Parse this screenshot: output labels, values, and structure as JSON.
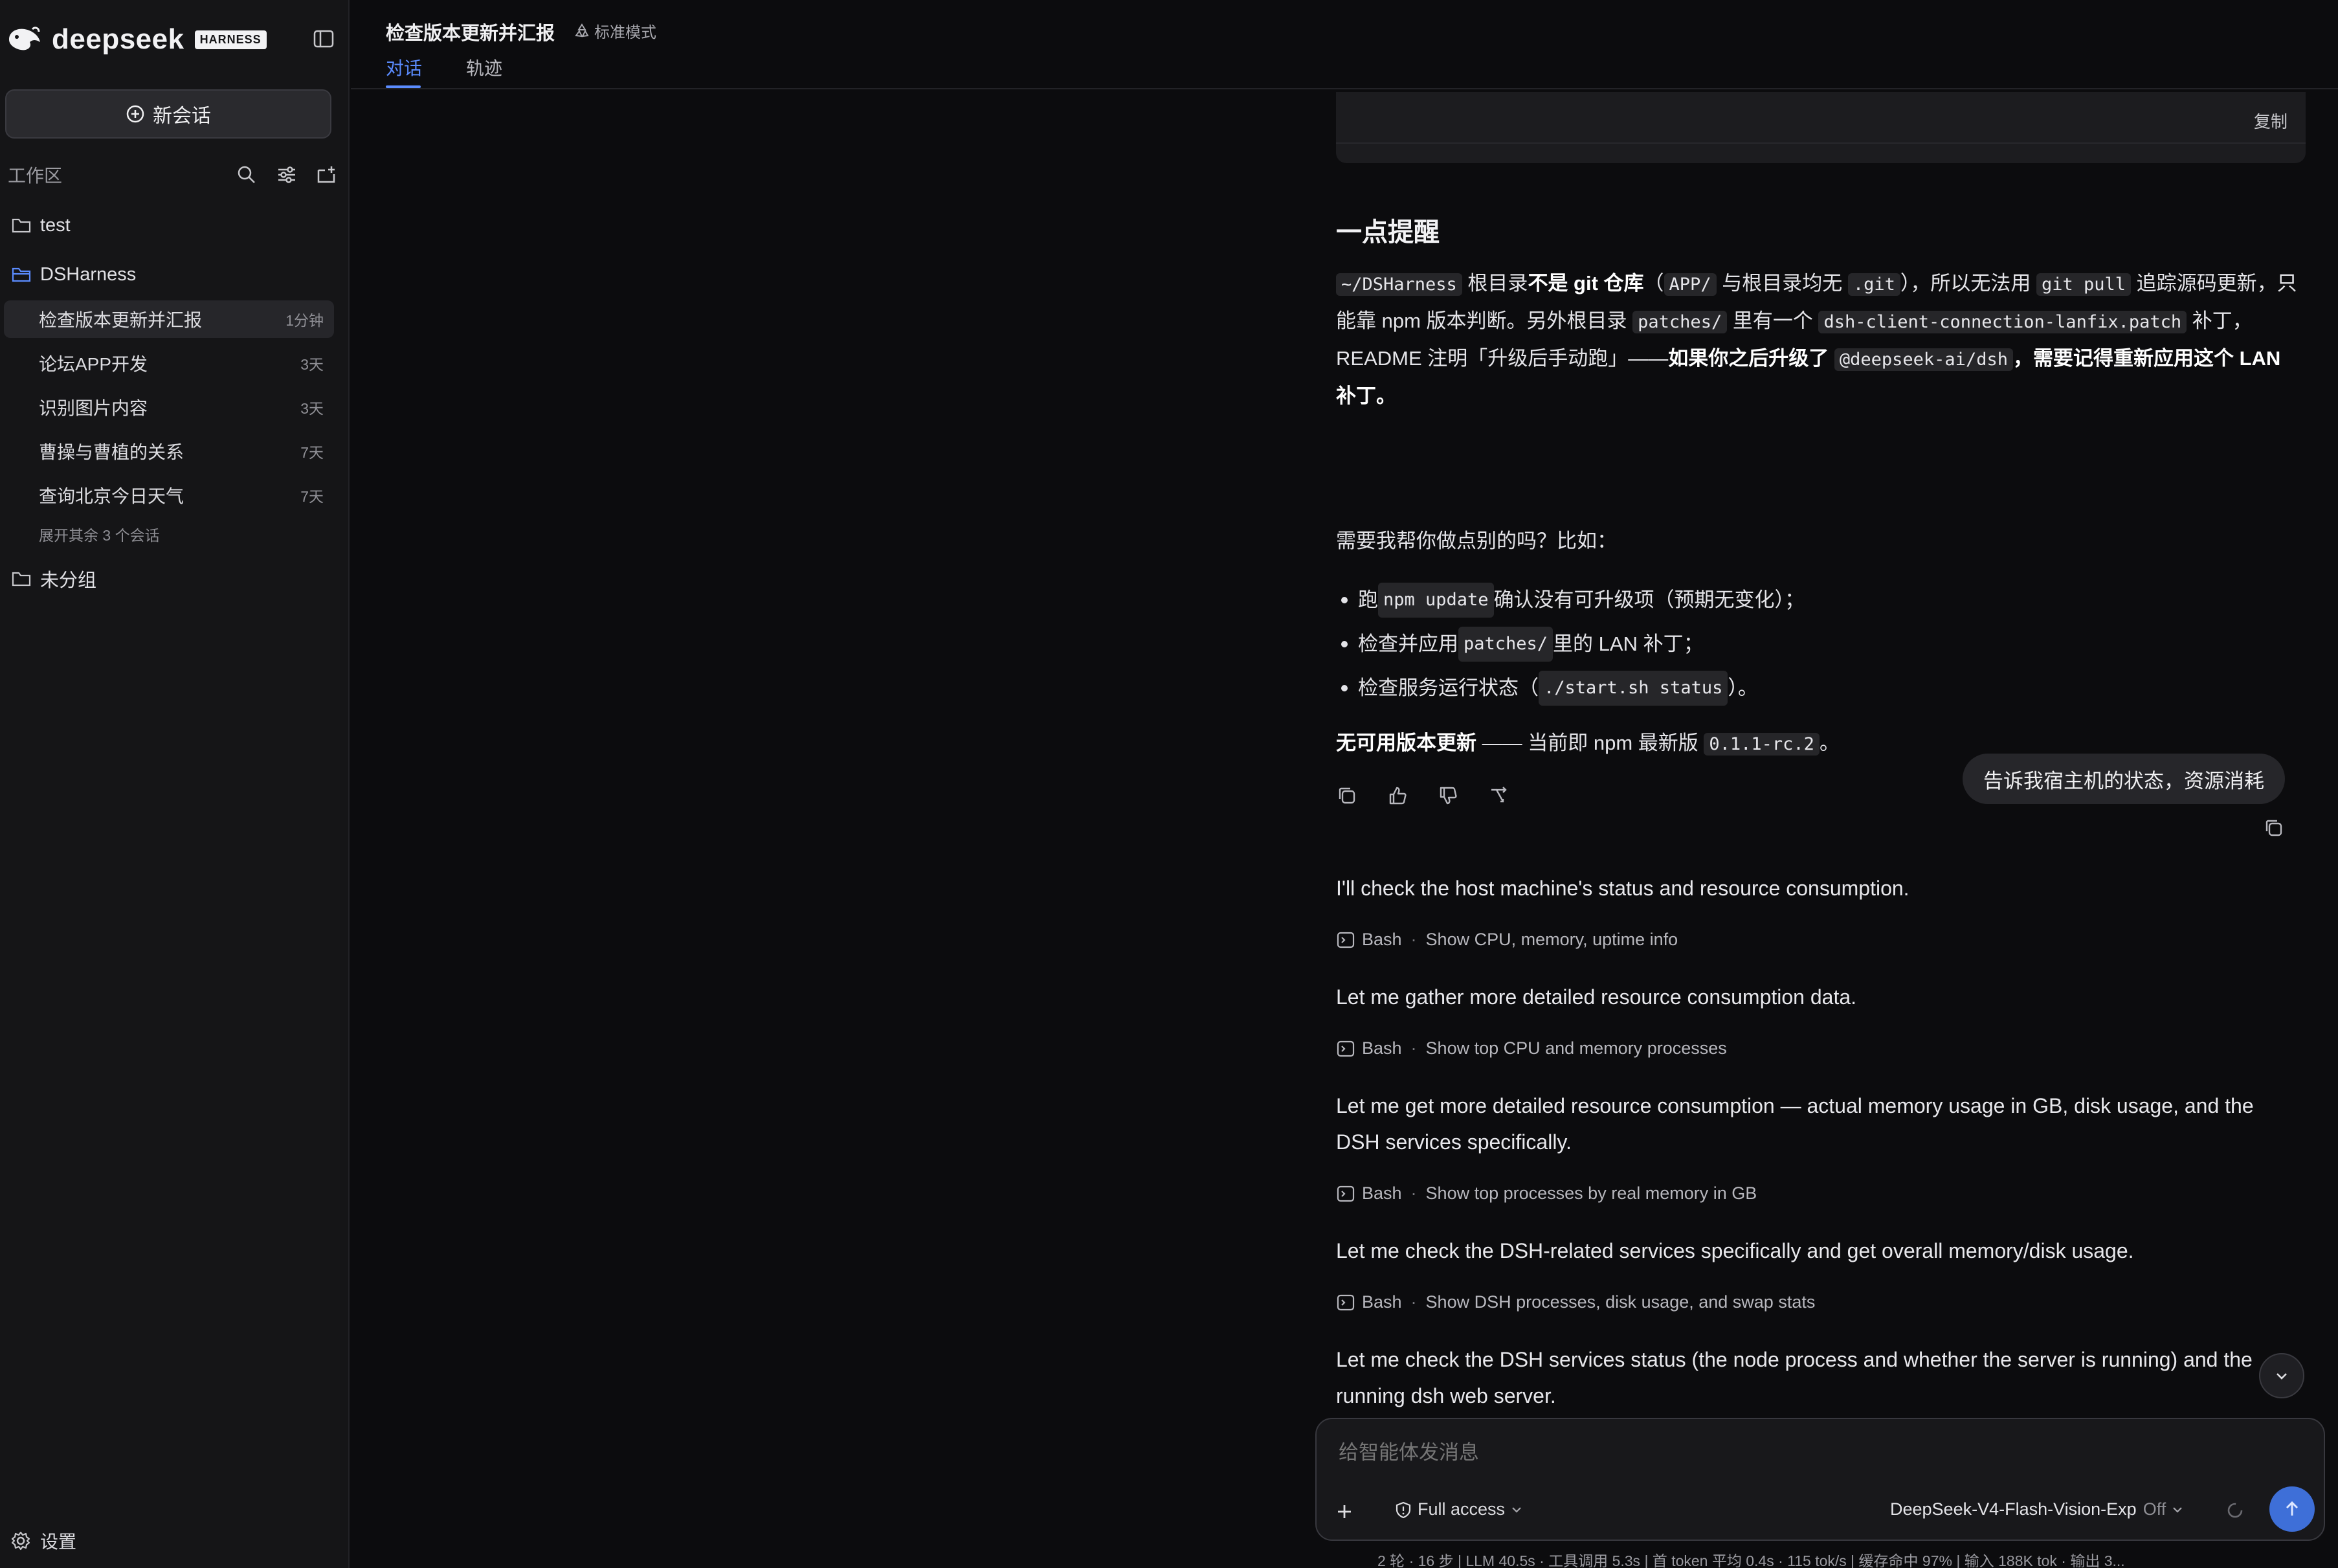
{
  "app": {
    "brand": "deepseek",
    "badge": "HARNESS"
  },
  "sidebar": {
    "new_chat": "新会话",
    "workspace_label": "工作区",
    "folders": [
      {
        "name": "test"
      },
      {
        "name": "DSHarness"
      },
      {
        "name": "未分组"
      }
    ],
    "conversations": [
      {
        "title": "检查版本更新并汇报",
        "age": "1分钟"
      },
      {
        "title": "论坛APP开发",
        "age": "3天"
      },
      {
        "title": "识别图片内容",
        "age": "3天"
      },
      {
        "title": "曹操与曹植的关系",
        "age": "7天"
      },
      {
        "title": "查询北京今日天气",
        "age": "7天"
      }
    ],
    "expand_more": "展开其余 3 个会话",
    "settings": "设置"
  },
  "header": {
    "title": "检查版本更新并汇报",
    "mode": "标准模式",
    "tabs": [
      "对话",
      "轨迹"
    ]
  },
  "chat": {
    "copy_label": "复制",
    "reminder_heading": "一点提醒",
    "reminder": {
      "p1_code1": "~/DSHarness",
      "p1_t1": " 根目录",
      "p1_b1": "不是 git 仓库",
      "p1_t2": "（",
      "p1_code2": "APP/",
      "p1_t3": " 与根目录均无 ",
      "p1_code3": ".git",
      "p1_t4": "），所以无法用 ",
      "p1_code4": "git pull",
      "p1_t5": " 追踪源码更新，只能靠 npm 版本判断。另外根目录 ",
      "p1_code5": "patches/",
      "p1_t6": " 里有一个 ",
      "p1_code6": "dsh-client-connection-lanfix.patch",
      "p1_t7": " 补丁，README 注明「升级后手动跑」——",
      "p1_b2": "如果你之后升级了 ",
      "p1_code7": "@deepseek-ai/dsh",
      "p1_b3": "，需要记得重新应用这个 LAN 补丁。"
    },
    "ask": "需要我帮你做点别的吗？比如：",
    "bullets": [
      {
        "pre": "跑 ",
        "code": "npm update",
        "post": " 确认没有可升级项（预期无变化）；"
      },
      {
        "pre": "检查并应用 ",
        "code": "patches/",
        "post": " 里的 LAN 补丁；"
      },
      {
        "pre": "检查服务运行状态（",
        "code": "./start.sh status",
        "post": "）。"
      }
    ],
    "summary_bold": "无可用版本更新",
    "summary_text": " —— 当前即 npm 最新版 ",
    "summary_code": "0.1.1-rc.2",
    "summary_end": "。",
    "user_message": "告诉我宿主机的状态，资源消耗",
    "assistant_steps": [
      {
        "text": "I'll check the host machine's status and resource consumption.",
        "tool": "Bash",
        "desc": "Show CPU, memory, uptime info"
      },
      {
        "text": "Let me gather more detailed resource consumption data.",
        "tool": "Bash",
        "desc": "Show top CPU and memory processes"
      },
      {
        "text": "Let me get more detailed resource consumption — actual memory usage in GB, disk usage, and the DSH services specifically.",
        "tool": "Bash",
        "desc": "Show top processes by real memory in GB"
      },
      {
        "text": "Let me check the DSH-related services specifically and get overall memory/disk usage.",
        "tool": "Bash",
        "desc": "Show DSH processes, disk usage, and swap stats"
      },
      {
        "text": "Let me check the DSH services status (the node process and whether the server is running) and the running dsh web server."
      }
    ]
  },
  "composer": {
    "placeholder": "给智能体发消息",
    "access": "Full access",
    "model": "DeepSeek-V4-Flash-Vision-Exp",
    "model_state": "Off"
  },
  "status_bar": "2 轮 · 16 步   |   LLM 40.5s · 工具调用 5.3s   |   首 token 平均 0.4s · 115 tok/s   |   缓存命中 97%   |   输入 188K tok · 输出 3...",
  "colors": {
    "accent": "#5b8cff",
    "send": "#3e6fd8",
    "folder_active": "#5b8cff"
  }
}
